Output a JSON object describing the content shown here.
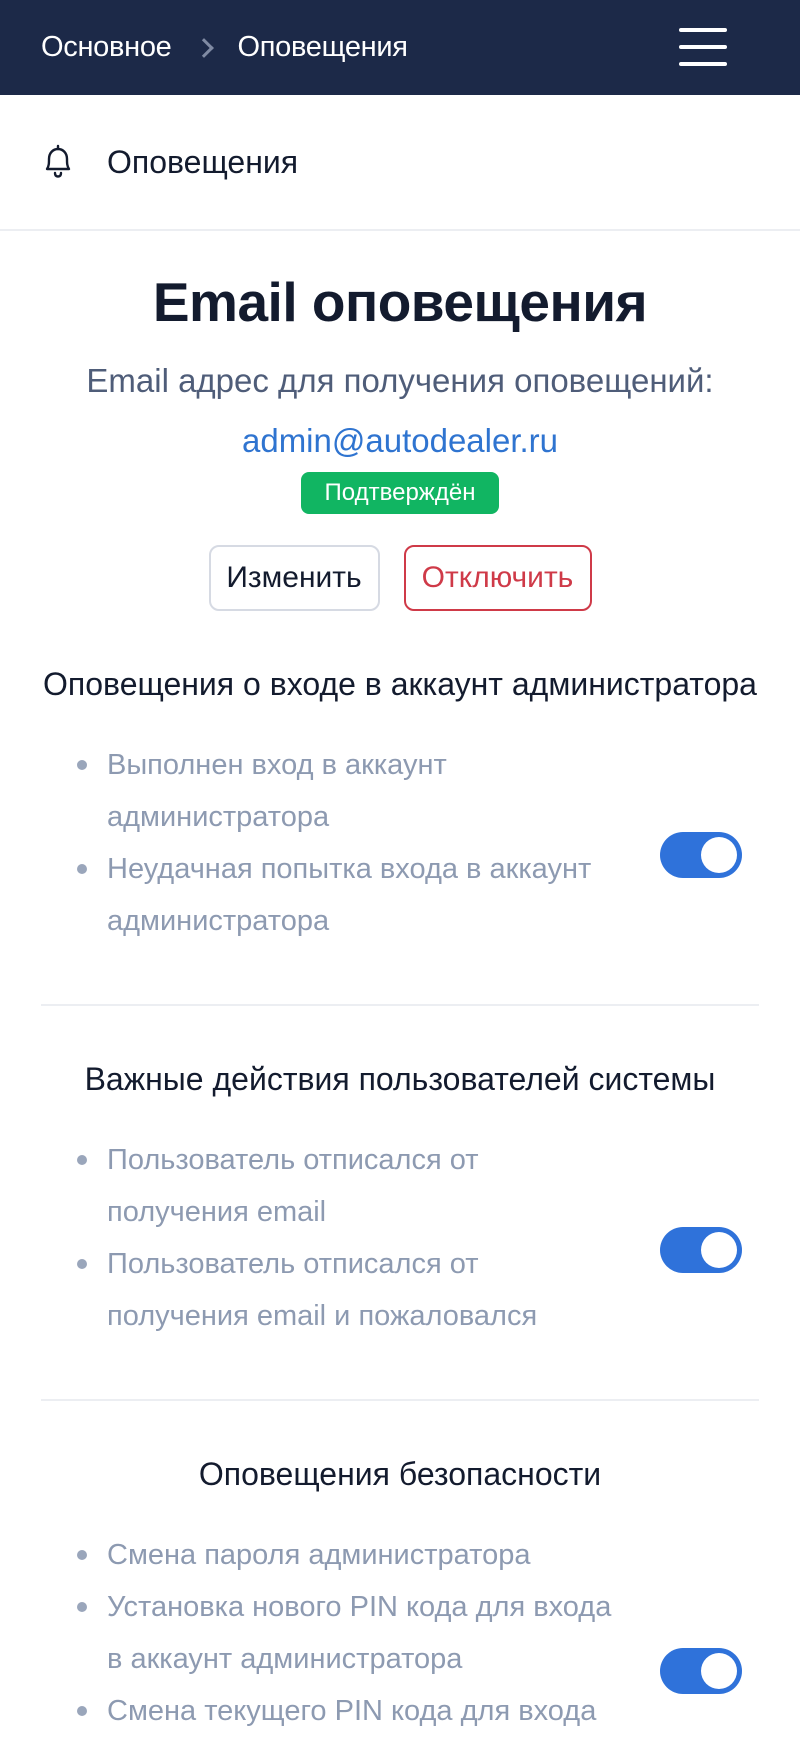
{
  "breadcrumb": {
    "items": [
      "Основное",
      "Оповещения"
    ]
  },
  "header": {
    "section_title": "Оповещения"
  },
  "email": {
    "title": "Email оповещения",
    "subtitle": "Email адрес для получения оповещений:",
    "address": "admin@autodealer.ru",
    "status_badge": "Подтверждён",
    "edit_label": "Изменить",
    "disable_label": "Отключить"
  },
  "groups": [
    {
      "title": "Оповещения о входе в аккаунт администратора",
      "items": [
        "Выполнен вход в аккаунт администратора",
        "Неудачная попытка входа в аккаунт администратора"
      ],
      "enabled": true
    },
    {
      "title": "Важные действия пользователей системы",
      "items": [
        "Пользователь отписался от получения email",
        "Пользователь отписался от получения email и пожаловался"
      ],
      "enabled": true
    },
    {
      "title": "Оповещения безопасности",
      "items": [
        "Смена пароля администратора",
        "Установка нового PIN кода для входа в аккаунт администратора",
        "Смена текущего PIN кода для входа"
      ],
      "enabled": true
    }
  ],
  "colors": {
    "topbar": "#1c2948",
    "accent": "#2f74d0",
    "success": "#11b562",
    "danger": "#cf3a48"
  }
}
